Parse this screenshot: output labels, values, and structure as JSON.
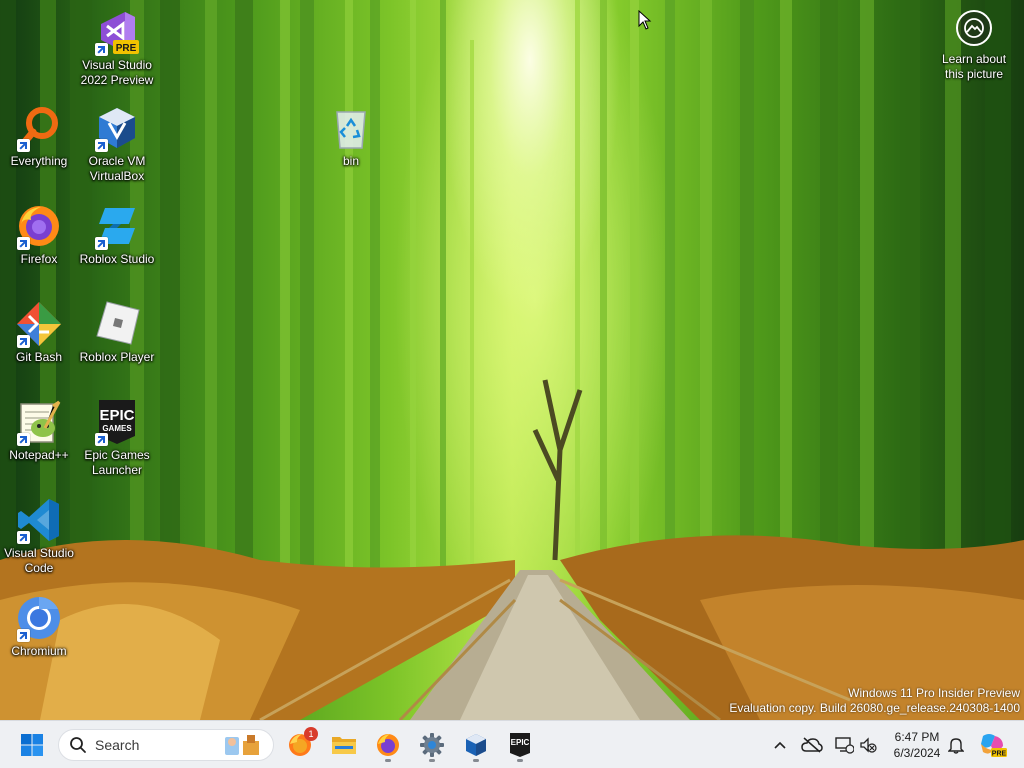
{
  "desktop": {
    "icons": [
      {
        "label": "Visual Studio\n2022 Preview",
        "icon": "visual-studio-preview-icon",
        "badge": "PRE"
      },
      {
        "label": "Everything",
        "icon": "everything-search-icon"
      },
      {
        "label": "Oracle VM\nVirtualBox",
        "icon": "virtualbox-icon"
      },
      {
        "label": "bin",
        "icon": "recycle-bin-icon"
      },
      {
        "label": "Firefox",
        "icon": "firefox-icon"
      },
      {
        "label": "Roblox Studio",
        "icon": "roblox-studio-icon"
      },
      {
        "label": "Git Bash",
        "icon": "git-bash-icon"
      },
      {
        "label": "Roblox Player",
        "icon": "roblox-player-icon"
      },
      {
        "label": "Notepad++",
        "icon": "notepad-plus-plus-icon"
      },
      {
        "label": "Epic Games\nLauncher",
        "icon": "epic-games-icon",
        "logo_text": [
          "EPIC",
          "GAMES"
        ]
      },
      {
        "label": "Visual Studio\nCode",
        "icon": "vscode-icon"
      },
      {
        "label": "Chromium",
        "icon": "chromium-icon"
      }
    ],
    "learn_about": {
      "label": "Learn about\nthis picture",
      "icon": "camera-learn-icon"
    },
    "watermark": {
      "line1": "Windows 11 Pro Insider Preview",
      "line2": "Evaluation copy. Build 26080.ge_release.240308-1400"
    }
  },
  "taskbar": {
    "search_placeholder": "Search",
    "pinned": [
      {
        "name": "start",
        "icon": "windows-start-icon"
      },
      {
        "name": "firefox-nightly",
        "icon": "firefox-nightly-icon",
        "badge": "1"
      },
      {
        "name": "file-explorer",
        "icon": "folder-icon"
      },
      {
        "name": "firefox",
        "icon": "firefox-icon",
        "running": true
      },
      {
        "name": "settings",
        "icon": "gear-icon",
        "running": true
      },
      {
        "name": "virtualbox",
        "icon": "virtualbox-icon",
        "running": true
      },
      {
        "name": "epic-games",
        "icon": "epic-games-icon",
        "running": true,
        "logo_text": "EPIC"
      }
    ],
    "tray": {
      "time": "6:47 PM",
      "date": "6/3/2024",
      "copilot_badge": "PRE"
    }
  },
  "colors": {
    "taskbar_bg": "#eef0f3",
    "accent_blue": "#0067c0"
  }
}
